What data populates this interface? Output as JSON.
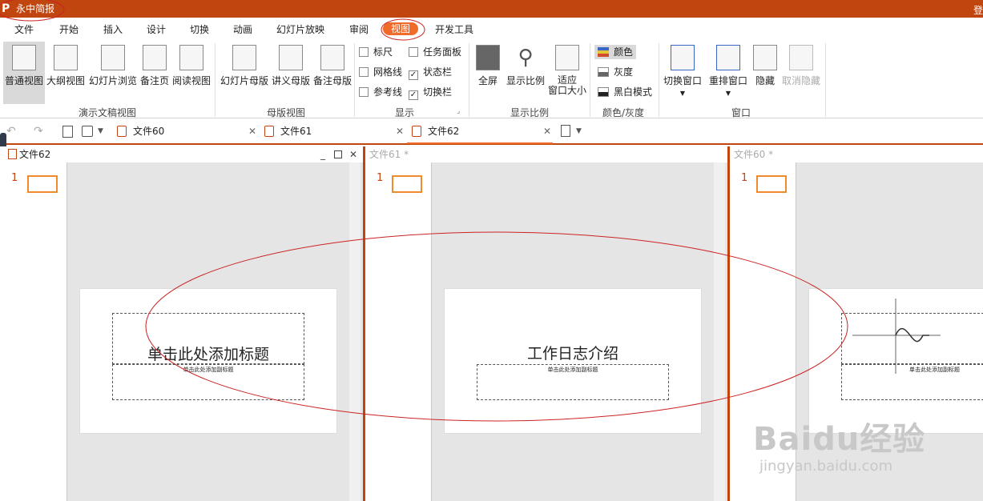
{
  "titlebar": {
    "app_title": "永中简报",
    "right_text": "登"
  },
  "menu": [
    "文件",
    "开始",
    "插入",
    "设计",
    "切换",
    "动画",
    "幻灯片放映",
    "审阅",
    "视图",
    "开发工具"
  ],
  "ribbon": {
    "presentation_views": {
      "group_label": "演示文稿视图",
      "items": [
        "普通视图",
        "大纲视图",
        "幻灯片浏览",
        "备注页",
        "阅读视图"
      ]
    },
    "master_views": {
      "group_label": "母版视图",
      "items": [
        "幻灯片母版",
        "讲义母版",
        "备注母版"
      ]
    },
    "display": {
      "group_label": "显示",
      "items": [
        {
          "label": "标尺",
          "checked": false
        },
        {
          "label": "任务面板",
          "checked": false
        },
        {
          "label": "网格线",
          "checked": false
        },
        {
          "label": "状态栏",
          "checked": true
        },
        {
          "label": "参考线",
          "checked": false
        },
        {
          "label": "切换栏",
          "checked": true
        }
      ]
    },
    "zoom": {
      "group_label": "显示比例",
      "items": [
        "全屏",
        "显示比例",
        "适应",
        "窗口大小"
      ]
    },
    "color": {
      "group_label": "颜色/灰度",
      "items": [
        "颜色",
        "灰度",
        "黑白模式"
      ]
    },
    "window": {
      "group_label": "窗口",
      "items": [
        "切换窗口",
        "重排窗口",
        "隐藏",
        "取消隐藏"
      ]
    }
  },
  "doc_tabs": [
    "文件60",
    "文件61",
    "文件62"
  ],
  "panes": [
    {
      "title": "文件62",
      "slide_num": "1",
      "slide_title": "单击此处添加标题",
      "slide_subtitle": "单击此处添加副标题"
    },
    {
      "title": "文件61 *",
      "slide_num": "1",
      "slide_title": "工作日志介绍",
      "slide_subtitle": "单击此处添加副标题"
    },
    {
      "title": "文件60 *",
      "slide_num": "1",
      "slide_title": "",
      "slide_subtitle": "单击此处添加副标题"
    }
  ],
  "watermark": {
    "brand": "Baidu经验",
    "url": "jingyan.baidu.com"
  },
  "colors": {
    "accent": "#c0450f",
    "tab_active": "#f06a2a",
    "thumb_border": "#f08a2a",
    "annotation": "#cc2222"
  }
}
